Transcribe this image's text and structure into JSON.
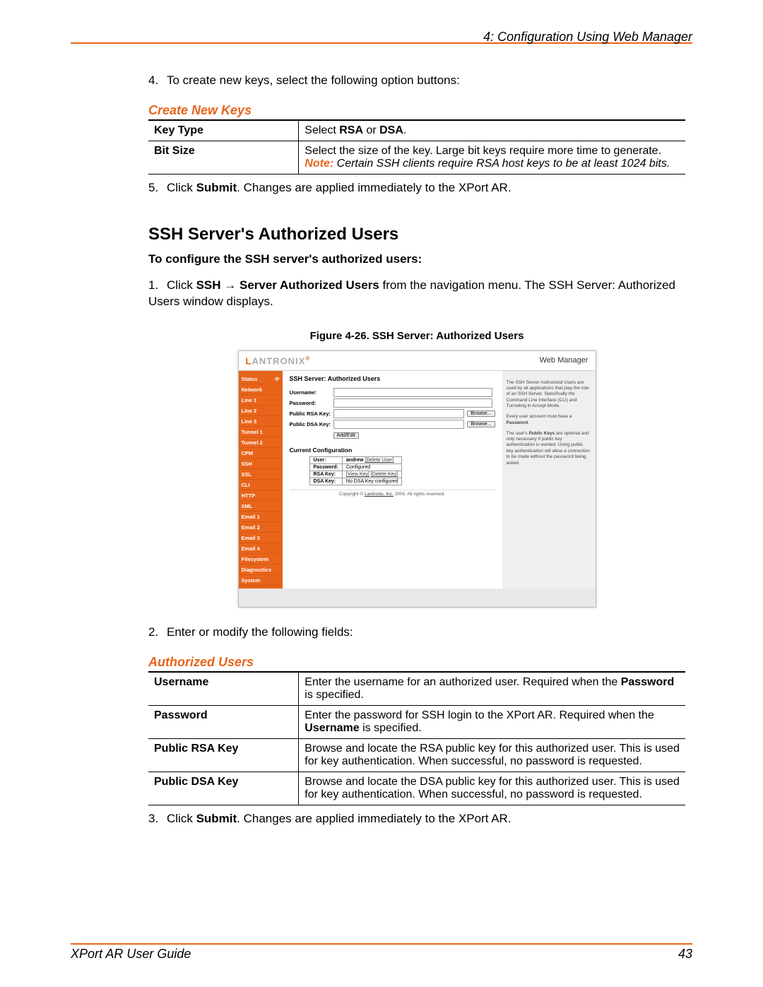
{
  "header": {
    "chapter": "4: Configuration Using Web Manager"
  },
  "steps": {
    "s4": "To create new keys, select the following option buttons:",
    "s5_pre": "Click ",
    "s5_bold": "Submit",
    "s5_post": ". Changes are applied immediately to the XPort AR.",
    "ssh_intro": "To configure the SSH server's authorized users:",
    "s1_pre": "Click ",
    "s1_b1": "SSH",
    "s1_arrow": " → ",
    "s1_b2": "Server Authorized Users",
    "s1_post": " from the navigation menu. The SSH Server: Authorized Users window displays.",
    "s2": "Enter or modify the following fields:",
    "s3_pre": "Click ",
    "s3_bold": "Submit",
    "s3_post": ". Changes are applied immediately to the XPort AR."
  },
  "create_keys": {
    "title": "Create New Keys",
    "rows": [
      {
        "k": "Key Type",
        "v_pre": "Select ",
        "v_b1": "RSA",
        "v_mid": " or ",
        "v_b2": "DSA",
        "v_post": "."
      },
      {
        "k": "Bit Size",
        "v_pre": "Select the size of the key. Large bit keys require more time to generate.",
        "note_label": "Note:",
        "note_text": " Certain SSH clients require RSA host keys to be at least 1024 bits."
      }
    ]
  },
  "sections": {
    "ssh_title": "SSH Server's Authorized Users",
    "fig_caption": "Figure 4-26. SSH Server: Authorized Users",
    "auth_title": "Authorized Users"
  },
  "auth_users": {
    "rows": [
      {
        "k": "Username",
        "v_pre": "Enter the username for an authorized user. Required when the ",
        "v_b": "Password",
        "v_post": " is specified."
      },
      {
        "k": "Password",
        "v_pre": "Enter the password for SSH login to the XPort AR. Required when the ",
        "v_b": "Username",
        "v_post": " is specified."
      },
      {
        "k": "Public RSA Key",
        "v": "Browse and locate the RSA public key for this authorized user.  This is used for key authentication. When successful, no password is requested."
      },
      {
        "k": "Public DSA Key",
        "v": "Browse and locate the DSA public key for this authorized user. This is used for key authentication. When successful, no password is requested."
      }
    ]
  },
  "shot": {
    "logo_l": "L",
    "logo_rest": "ANTRONIX",
    "wm": "Web Manager",
    "nav": [
      "Status",
      "Network",
      "Line 1",
      "Line 2",
      "Line 3",
      "Tunnel 1",
      "Tunnel 2",
      "CPM",
      "SSH",
      "SSL",
      "CLI",
      "HTTP",
      "XML",
      "Email 1",
      "Email 2",
      "Email 3",
      "Email 4",
      "Filesystem",
      "Diagnostics",
      "System"
    ],
    "title": "SSH Server: Authorized Users",
    "labels": {
      "user": "Username:",
      "pass": "Password:",
      "rsa": "Public RSA Key:",
      "dsa": "Public DSA Key:"
    },
    "buttons": {
      "browse": "Browse...",
      "add": "Add/Edit"
    },
    "sub": "Current Configuration",
    "conf": {
      "user_k": "User:",
      "user_v": "andrew",
      "user_a": "[Delete User]",
      "pass_k": "Password:",
      "pass_v": "Configured",
      "rsa_k": "RSA Key:",
      "rsa_a1": "[View Key]",
      "rsa_a2": "[Delete Key]",
      "dsa_k": "DSA Key:",
      "dsa_v": "No DSA Key configured"
    },
    "side": {
      "p1": "The SSH Server Authorized Users are used by all applications that play the role of an SSH Server. Specifically the Command Line Interface (CLI) and Tunneling in Accept Mode.",
      "p2_pre": "Every user account must have a ",
      "p2_b": "Password",
      "p2_post": ".",
      "p3_pre": "The user's ",
      "p3_b": "Public Keys",
      "p3_post": " are optional and only necessary if public key authentication is wanted. Using public key authentication will allow a connection to be made without the password being asked."
    },
    "copy_pre": "Copyright © ",
    "copy_link": "Lantronix, Inc.",
    "copy_post": " 2005. All rights reserved."
  },
  "footer": {
    "left": "XPort AR User Guide",
    "right": "43"
  }
}
